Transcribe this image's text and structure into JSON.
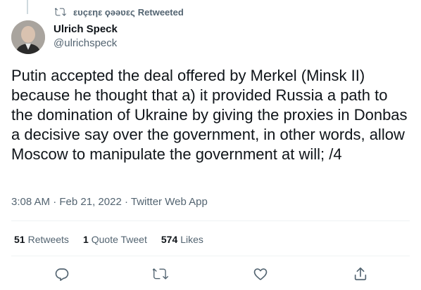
{
  "retweet_banner": {
    "retweeter": "ευçεηε ϙəəʋες",
    "suffix": "Retweeted"
  },
  "author": {
    "name": "Ulrich Speck",
    "handle": "@ulrichspeck"
  },
  "tweet": {
    "text": "Putin accepted the deal offered by Merkel (Minsk II) because he thought that a) it provided Russia a path to the domination of Ukraine by giving the proxies in Donbas a decisive say over the government, in other words, allow Moscow to manipulate the government at will; /4"
  },
  "meta": {
    "time": "3:08 AM",
    "date": "Feb 21, 2022",
    "source": "Twitter Web App",
    "separator": "·"
  },
  "stats": {
    "retweets": {
      "count": "51",
      "label": "Retweets"
    },
    "quotes": {
      "count": "1",
      "label": "Quote Tweet"
    },
    "likes": {
      "count": "574",
      "label": "Likes"
    }
  },
  "icons": {
    "retweet_banner": "retweet-icon",
    "reply": "reply-icon",
    "retweet": "retweet-icon",
    "like": "heart-icon",
    "share": "share-icon"
  },
  "colors": {
    "text": "#0f1419",
    "secondary": "#536471",
    "divider": "#eff3f4"
  }
}
